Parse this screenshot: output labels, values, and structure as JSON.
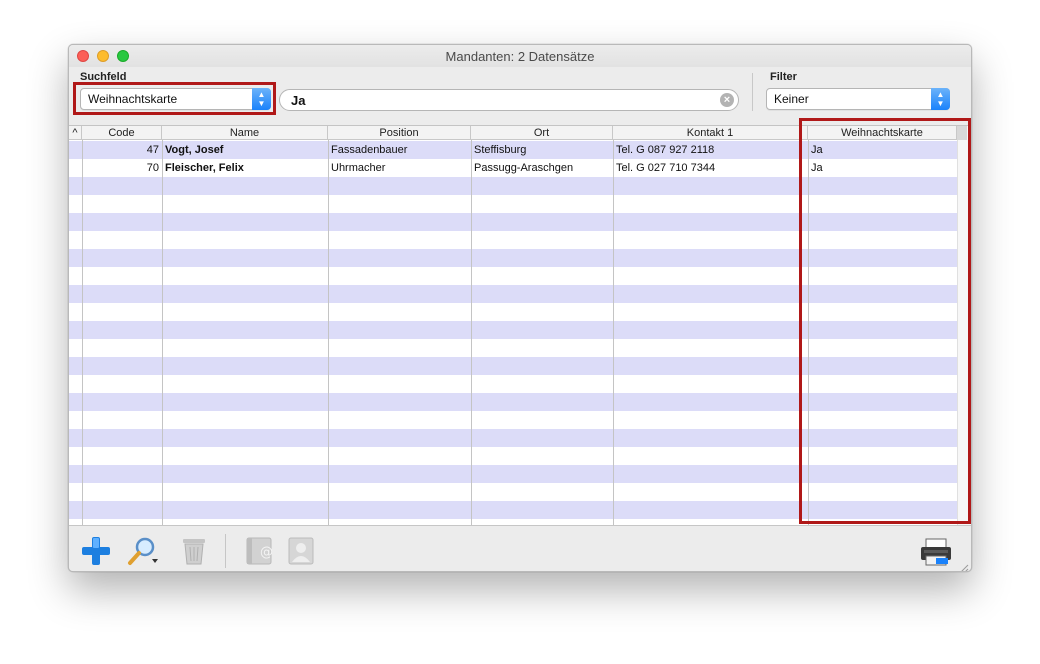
{
  "window": {
    "title": "Mandanten: 2 Datensätze"
  },
  "search": {
    "field_label": "Suchfeld",
    "field_value": "Weihnachtskarte",
    "query_value": "Ja",
    "filter_label": "Filter",
    "filter_value": "Keiner"
  },
  "table": {
    "sort_indicator": "^",
    "columns": [
      "Code",
      "Name",
      "Position",
      "Ort",
      "Kontakt 1",
      "Weihnachtskarte"
    ],
    "rows": [
      {
        "code": "47",
        "name": "Vogt, Josef",
        "position": "Fassadenbauer",
        "ort": "Steffisburg",
        "kontakt": "Tel. G 087 927 2118",
        "weihnachtskarte": "Ja"
      },
      {
        "code": "70",
        "name": "Fleischer, Felix",
        "position": "Uhrmacher",
        "ort": "Passugg-Araschgen",
        "kontakt": "Tel. G 027 710 7344",
        "weihnachtskarte": "Ja"
      }
    ]
  },
  "toolbar": {
    "icons": [
      "add-icon",
      "search-magnifier-icon",
      "trash-icon",
      "address-book-icon",
      "contact-card-icon",
      "printer-icon"
    ]
  },
  "colors": {
    "row_stripe": "#dcdcf8",
    "accent_blue": "#1a82fb",
    "highlight_red": "#b01818"
  }
}
